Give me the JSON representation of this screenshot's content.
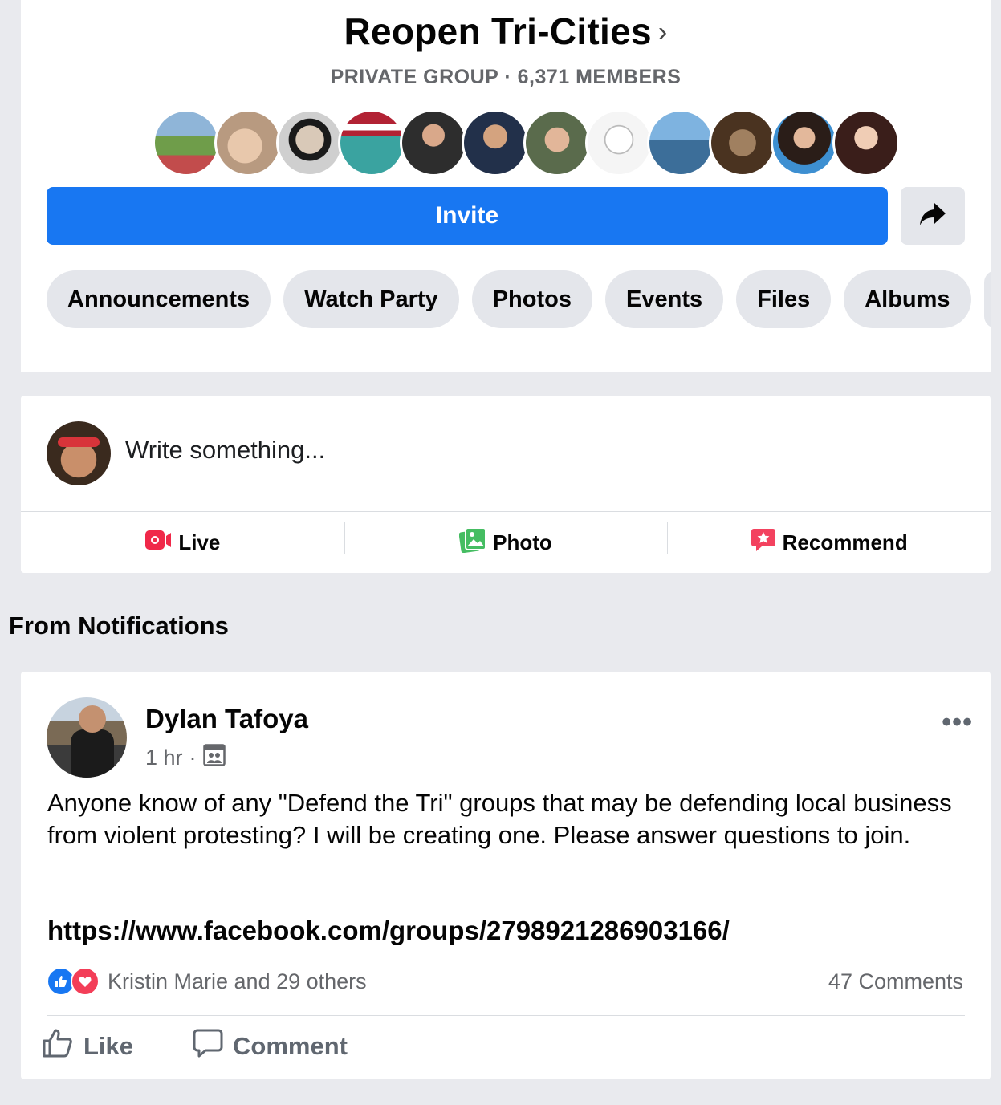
{
  "group": {
    "title": "Reopen Tri-Cities",
    "chevron": "›",
    "subtitle": "PRIVATE GROUP · 6,371 MEMBERS",
    "invite_label": "Invite",
    "tabs": [
      "Announcements",
      "Watch Party",
      "Photos",
      "Events",
      "Files",
      "Albums"
    ]
  },
  "composer": {
    "placeholder": "Write something...",
    "actions": [
      {
        "label": "Live",
        "icon": "live-video-icon",
        "color": "#f02849"
      },
      {
        "label": "Photo",
        "icon": "photo-icon",
        "color": "#45bd62"
      },
      {
        "label": "Recommend",
        "icon": "recommend-icon",
        "color": "#f3425f"
      }
    ]
  },
  "section_heading": "From Notifications",
  "post": {
    "author": "Dylan Tafoya",
    "time": "1 hr",
    "separator": "·",
    "audience_icon": "group-audience-icon",
    "more": "•••",
    "text": "Anyone know of any \"Defend the Tri\" groups that may be defending local business from violent protesting? I will be creating one. Please answer questions to join.",
    "link": "https://www.facebook.com/groups/279892128690316​6/",
    "reactions_text": "Kristin Marie and 29 others",
    "comments_text": "47 Comments",
    "like_label": "Like",
    "comment_label": "Comment"
  },
  "colors": {
    "primary": "#1877f2",
    "background": "#e9eaee",
    "secondary_text": "#65676b"
  }
}
